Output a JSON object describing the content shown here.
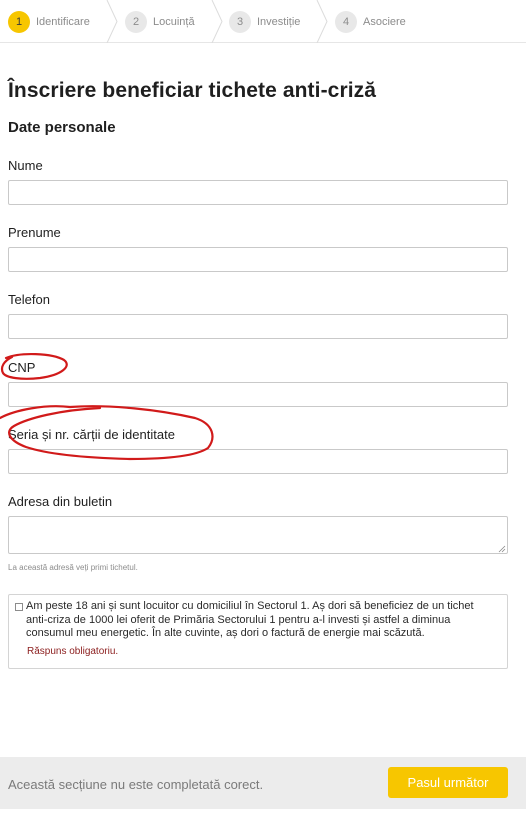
{
  "stepper": {
    "steps": [
      {
        "number": "1",
        "label": "Identificare",
        "state": "active"
      },
      {
        "number": "2",
        "label": "Locuință",
        "state": "inactive"
      },
      {
        "number": "3",
        "label": "Investiție",
        "state": "inactive"
      },
      {
        "number": "4",
        "label": "Asociere",
        "state": "inactive"
      }
    ]
  },
  "page": {
    "title": "Înscriere beneficiar tichete anti-criză",
    "section_title": "Date personale"
  },
  "form": {
    "fields": [
      {
        "label": "Nume",
        "value": ""
      },
      {
        "label": "Prenume",
        "value": ""
      },
      {
        "label": "Telefon",
        "value": ""
      },
      {
        "label": "CNP",
        "value": ""
      },
      {
        "label": "Seria și nr. cărții de identitate",
        "value": ""
      },
      {
        "label": "Adresa din buletin",
        "value": ""
      }
    ],
    "address_help": "La această adresă veți primi tichetul."
  },
  "consent": {
    "text": "Am peste 18 ani și sunt locuitor cu domiciliul în Sectorul 1. Aș dori să beneficiez de un tichet anti-criza de 1000 lei oferit de Primăria Sectorului 1 pentru a-l investi și astfel a diminua consumul meu energetic. În alte cuvinte, aș dori o factură de energie mai scăzută.",
    "error": "Răspuns obligatoriu.",
    "checked": false
  },
  "footer": {
    "status_text": "Această secțiune nu este completată corect.",
    "next_label": "Pasul următor"
  },
  "colors": {
    "accent": "#f7c600",
    "error": "#8b1d1d",
    "annotation": "#d11a1a",
    "footer_bg": "#ececec"
  }
}
